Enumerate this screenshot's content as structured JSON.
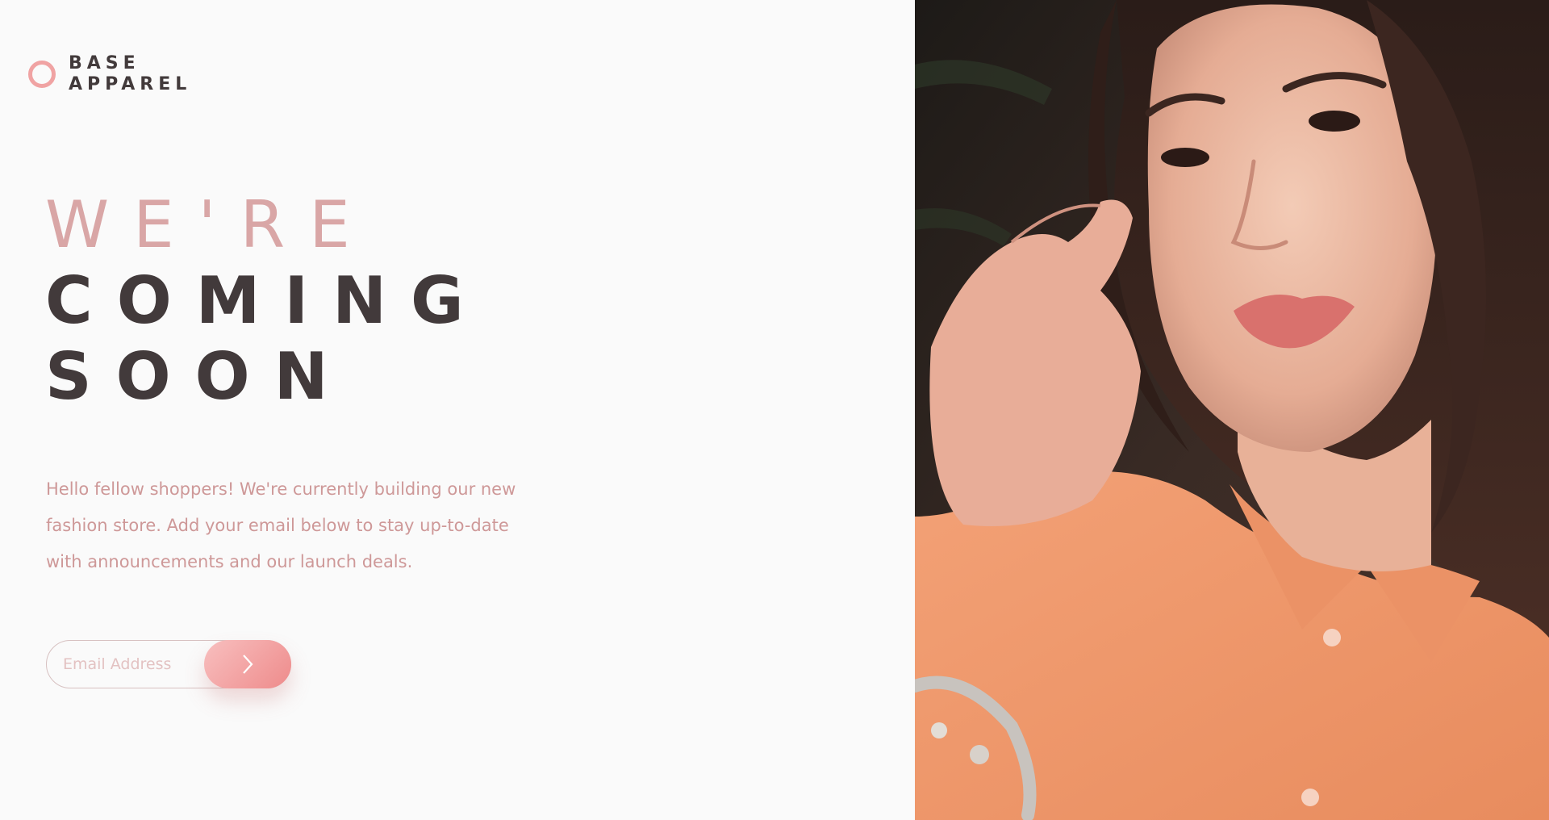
{
  "brand": {
    "line1": "BASE",
    "line2": "APPAREL",
    "accent": "#f0a3a3",
    "dark": "#423a3b"
  },
  "hero": {
    "line1": "WE'RE",
    "line2": "COMING",
    "line3": "SOON"
  },
  "intro": {
    "text": "Hello fellow shoppers! We're currently building our new fashion store. Add your email below to stay up-to-date with announcements and our launch deals."
  },
  "form": {
    "email_placeholder": "Email Address",
    "email_value": "",
    "submit_icon": "chevron-right-icon"
  },
  "hero_image": {
    "subject": "woman in peach shirt touching hair"
  }
}
